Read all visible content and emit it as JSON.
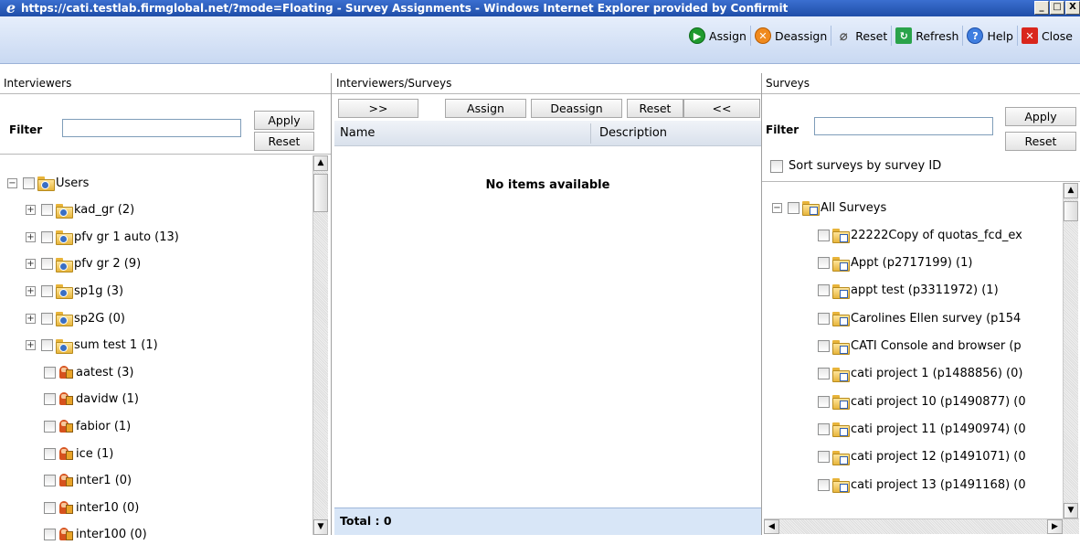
{
  "window": {
    "title": "https://cati.testlab.firmglobal.net/?mode=Floating - Survey Assignments - Windows Internet Explorer provided by Confirmit",
    "controls": [
      "_",
      "□",
      "X"
    ]
  },
  "toolbar": {
    "items": [
      {
        "label": "Assign",
        "icon": "assign-icon"
      },
      {
        "label": "Deassign",
        "icon": "deassign-icon"
      },
      {
        "label": "Reset",
        "icon": "reset-icon"
      },
      {
        "label": "Refresh",
        "icon": "refresh-icon"
      },
      {
        "label": "Help",
        "icon": "help-icon"
      },
      {
        "label": "Close",
        "icon": "close-icon"
      }
    ]
  },
  "interviewers": {
    "header": "Interviewers",
    "filter_label": "Filter",
    "filter_value": "",
    "apply_label": "Apply",
    "reset_label": "Reset",
    "tree": [
      {
        "label": "Users",
        "type": "group-root",
        "expander": "−"
      },
      {
        "label": "kad_gr (2)",
        "type": "group",
        "expander": "+"
      },
      {
        "label": "pfv gr 1 auto (13)",
        "type": "group",
        "expander": "+"
      },
      {
        "label": "pfv gr 2 (9)",
        "type": "group",
        "expander": "+"
      },
      {
        "label": "sp1g (3)",
        "type": "group",
        "expander": "+"
      },
      {
        "label": "sp2G (0)",
        "type": "group",
        "expander": "+"
      },
      {
        "label": "sum test 1 (1)",
        "type": "group",
        "expander": "+"
      },
      {
        "label": "aatest (3)",
        "type": "user"
      },
      {
        "label": "davidw (1)",
        "type": "user"
      },
      {
        "label": "fabior (1)",
        "type": "user"
      },
      {
        "label": "ice (1)",
        "type": "user"
      },
      {
        "label": "inter1 (0)",
        "type": "user"
      },
      {
        "label": "inter10 (0)",
        "type": "user"
      },
      {
        "label": "inter100 (0)",
        "type": "user"
      }
    ]
  },
  "assignments": {
    "header": "Interviewers/Surveys",
    "buttons": {
      "move_right": ">>",
      "assign": "Assign",
      "deassign": "Deassign",
      "reset": "Reset",
      "move_left": "<<"
    },
    "columns": [
      "Name",
      "Description"
    ],
    "empty_text": "No items available",
    "total_text": "Total : 0"
  },
  "surveys": {
    "header": "Surveys",
    "filter_label": "Filter",
    "filter_value": "",
    "apply_label": "Apply",
    "reset_label": "Reset",
    "sort_label": "Sort surveys by survey ID",
    "sort_checked": false,
    "tree": [
      {
        "label": "All Surveys",
        "type": "root",
        "expander": "−"
      },
      {
        "label": "22222Copy of quotas_fcd_ex",
        "type": "survey"
      },
      {
        "label": "Appt (p2717199) (1)",
        "type": "survey"
      },
      {
        "label": "appt test (p3311972) (1)",
        "type": "survey"
      },
      {
        "label": "Carolines Ellen survey (p154",
        "type": "survey"
      },
      {
        "label": "CATI Console and browser (p",
        "type": "survey"
      },
      {
        "label": "cati project 1 (p1488856) (0)",
        "type": "survey"
      },
      {
        "label": "cati project 10 (p1490877) (0",
        "type": "survey"
      },
      {
        "label": "cati project 11 (p1490974) (0",
        "type": "survey"
      },
      {
        "label": "cati project 12 (p1491071) (0",
        "type": "survey"
      },
      {
        "label": "cati project 13 (p1491168) (0",
        "type": "survey"
      }
    ]
  }
}
